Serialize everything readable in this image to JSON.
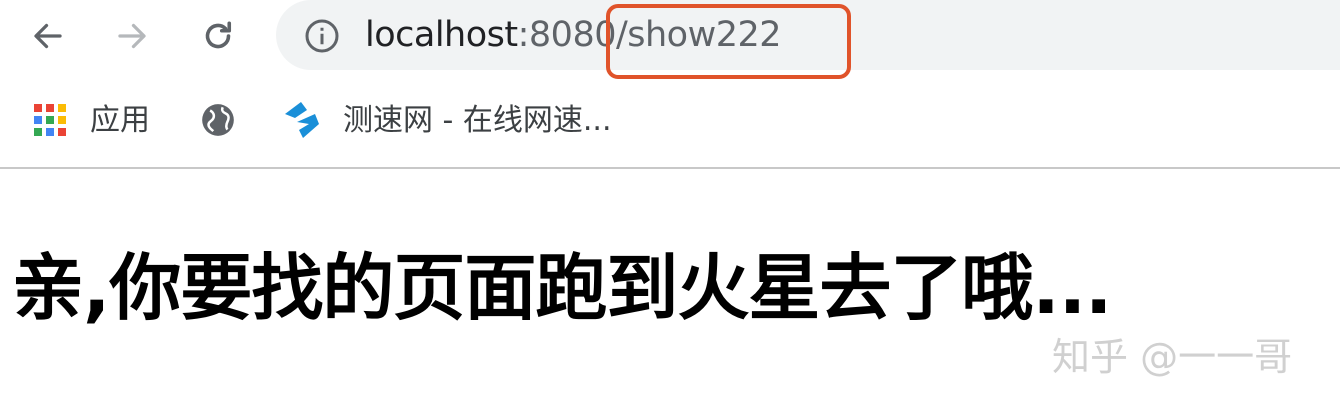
{
  "toolbar": {
    "url_host": "localhost",
    "url_rest": ":8080/show222"
  },
  "bookmarks": {
    "items": [
      {
        "label": "应用",
        "icon": "apps-grid-icon"
      },
      {
        "label": "",
        "icon": "globe-icon"
      },
      {
        "label": "测速网 - 在线网速...",
        "icon": "speedtest-logo-icon"
      }
    ]
  },
  "page": {
    "heading": "亲,你要找的页面跑到火星去了哦..."
  },
  "watermark": {
    "text": "知乎 @一一哥"
  },
  "colors": {
    "highlight": "#e0532a",
    "omnibox_bg": "#f1f3f4",
    "speed_logo": "#1a8fd8"
  }
}
